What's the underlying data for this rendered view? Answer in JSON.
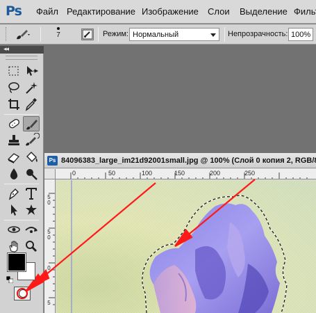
{
  "app": {
    "logo": "Ps"
  },
  "menu": {
    "items": [
      {
        "label": "Файл"
      },
      {
        "label": "Редактирование"
      },
      {
        "label": "Изображение"
      },
      {
        "label": "Слои"
      },
      {
        "label": "Выделение"
      },
      {
        "label": "Фильт"
      }
    ]
  },
  "options": {
    "brush_size": "7",
    "mode_label": "Режим:",
    "mode_value": "Нормальный",
    "opacity_label": "Непрозрачность:",
    "opacity_value": "100%"
  },
  "toolbox": {
    "collapse_glyph": "◂◂",
    "tools": [
      {
        "icon": "rectangular-marquee-icon"
      },
      {
        "icon": "move-icon"
      },
      {
        "icon": "lasso-icon"
      },
      {
        "icon": "magic-wand-icon"
      },
      {
        "icon": "crop-icon"
      },
      {
        "icon": "eyedropper-icon"
      },
      {
        "icon": "spot-healing-brush-icon"
      },
      {
        "icon": "brush-icon",
        "active": true
      },
      {
        "icon": "clone-stamp-icon"
      },
      {
        "icon": "history-brush-icon"
      },
      {
        "icon": "eraser-icon"
      },
      {
        "icon": "paint-bucket-icon"
      },
      {
        "icon": "blur-icon"
      },
      {
        "icon": "dodge-icon"
      },
      {
        "icon": "pen-icon"
      },
      {
        "icon": "type-icon"
      },
      {
        "icon": "path-selection-icon"
      },
      {
        "icon": "custom-shape-icon"
      },
      {
        "icon": "3d-rotate-icon"
      },
      {
        "icon": "3d-orbit-icon"
      },
      {
        "icon": "hand-icon"
      },
      {
        "icon": "zoom-icon"
      }
    ],
    "foreground_color": "#000000",
    "background_color": "#ffffff",
    "quick_mask": "quick-mask-icon"
  },
  "document": {
    "title": "84096383_large_im21d92001small.jpg @ 100% (Слой 0 копия 2, RGB/8",
    "ruler_top": [
      "0",
      "50",
      "100",
      "150",
      "200",
      "250"
    ],
    "ruler_left": [
      "5",
      "0",
      "5",
      "0",
      "0",
      "5"
    ]
  },
  "colors": {
    "annotation_arrow": "#ff1a1a",
    "menubar_bg": "#d9d9d9",
    "workspace_bg": "#727272"
  }
}
